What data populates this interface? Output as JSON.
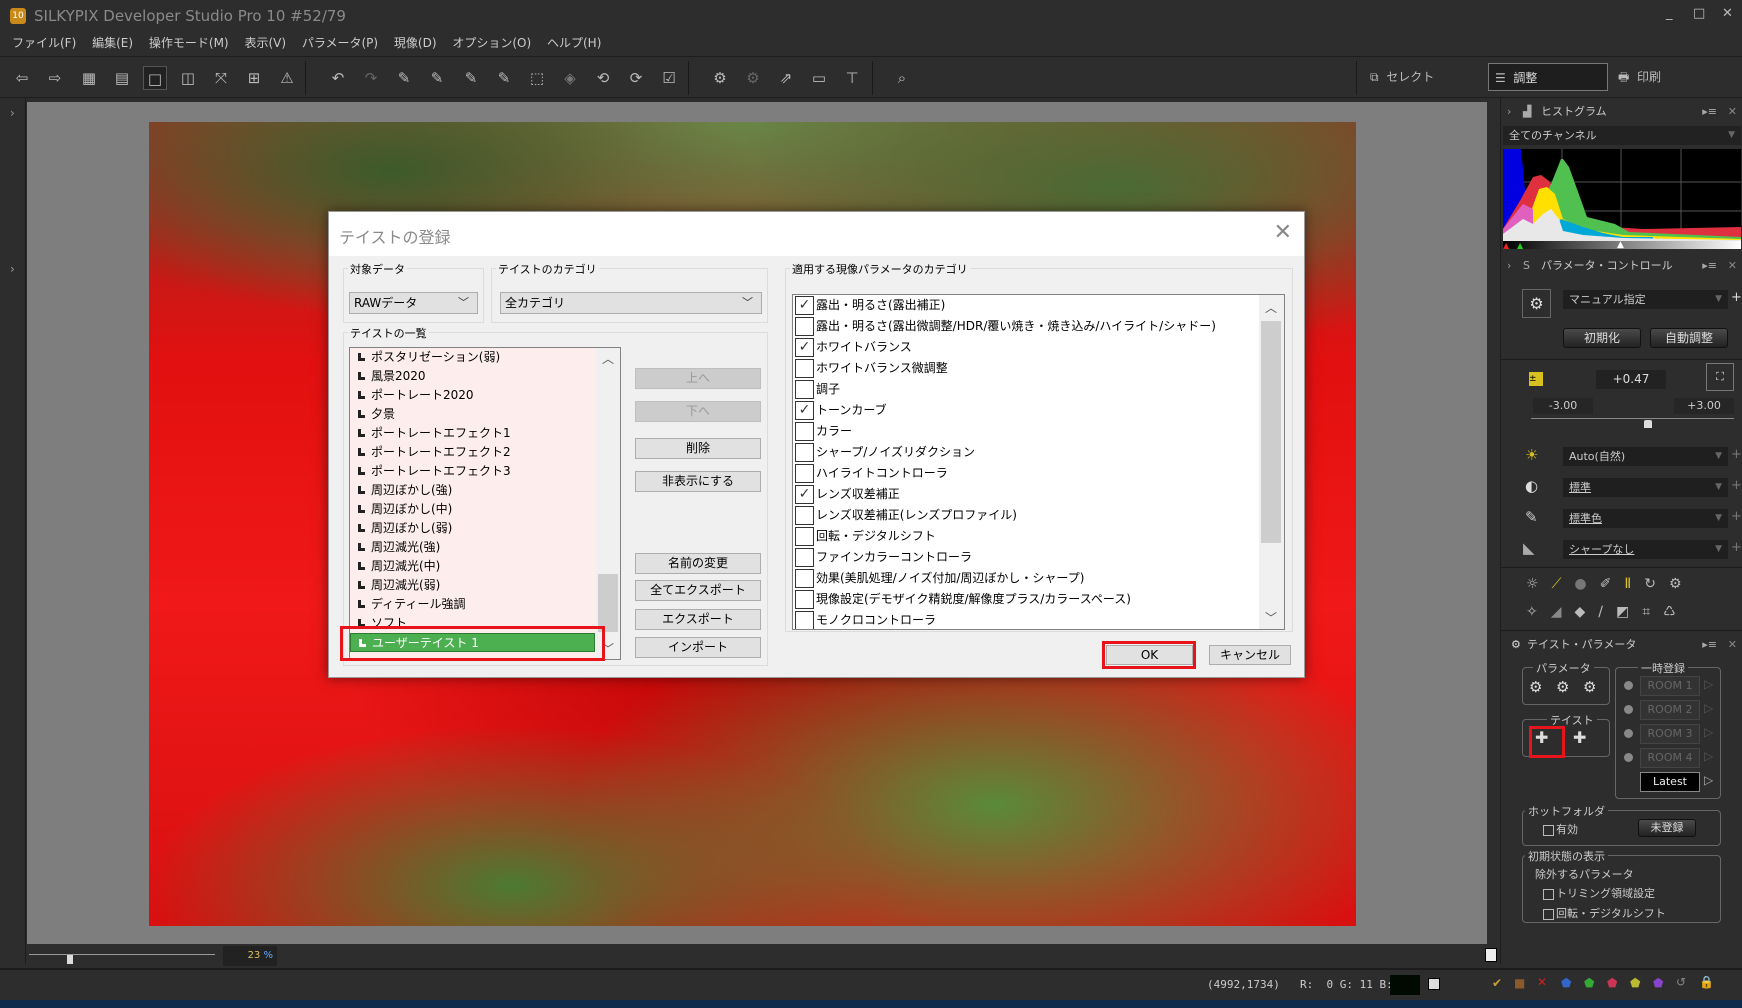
{
  "app": {
    "title": "SILKYPIX Developer Studio Pro 10   #52/79",
    "icon_label": "10"
  },
  "menu": [
    "ファイル(F)",
    "編集(E)",
    "操作モード(M)",
    "表示(V)",
    "パラメータ(P)",
    "現像(D)",
    "オプション(O)",
    "ヘルプ(H)"
  ],
  "modes": {
    "select": "セレクト",
    "adjust": "調整",
    "print": "印刷"
  },
  "zoom": {
    "value": "23",
    "unit": "%"
  },
  "status": {
    "coords": "(4992,1734)",
    "rgb": "R:  0 G: 11 B:  0",
    "swatch_color": "#000a00"
  },
  "dialog": {
    "title": "テイストの登録",
    "target_label": "対象データ",
    "target_value": "RAWデータ",
    "category_label": "テイストのカテゴリ",
    "category_value": "全カテゴリ",
    "list_label": "テイストの一覧",
    "tastes": [
      "ポスタリゼーション(弱)",
      "風景2020",
      "ポートレート2020",
      "夕景",
      "ポートレートエフェクト1",
      "ポートレートエフェクト2",
      "ポートレートエフェクト3",
      "周辺ぼかし(強)",
      "周辺ぼかし(中)",
      "周辺ぼかし(弱)",
      "周辺減光(強)",
      "周辺減光(中)",
      "周辺減光(弱)",
      "ディティール強調",
      "ソフト"
    ],
    "selected_taste": "ユーザーテイスト 1",
    "buttons": {
      "up": "上へ",
      "down": "下へ",
      "delete": "削除",
      "hide": "非表示にする",
      "rename": "名前の変更",
      "export_all": "全てエクスポート",
      "export": "エクスポート",
      "import": "インポート",
      "ok": "OK",
      "cancel": "キャンセル"
    },
    "params_label": "適用する現像パラメータのカテゴリ",
    "params": [
      {
        "label": "露出・明るさ(露出補正)",
        "checked": true
      },
      {
        "label": "露出・明るさ(露出微調整/HDR/覆い焼き・焼き込み/ハイライト/シャドー)",
        "checked": false
      },
      {
        "label": "ホワイトバランス",
        "checked": true
      },
      {
        "label": "ホワイトバランス微調整",
        "checked": false
      },
      {
        "label": "調子",
        "checked": false
      },
      {
        "label": "トーンカーブ",
        "checked": true
      },
      {
        "label": "カラー",
        "checked": false
      },
      {
        "label": "シャープ/ノイズリダクション",
        "checked": false
      },
      {
        "label": "ハイライトコントローラ",
        "checked": false
      },
      {
        "label": "レンズ収差補正",
        "checked": true
      },
      {
        "label": "レンズ収差補正(レンズプロファイル)",
        "checked": false
      },
      {
        "label": "回転・デジタルシフト",
        "checked": false
      },
      {
        "label": "ファインカラーコントローラ",
        "checked": false
      },
      {
        "label": "効果(美肌処理/ノイズ付加/周辺ぼかし・シャープ)",
        "checked": false
      },
      {
        "label": "現像設定(デモザイク精鋭度/解像度プラス/カラースペース)",
        "checked": false
      },
      {
        "label": "モノクロコントローラ",
        "checked": false
      }
    ]
  },
  "histogram": {
    "title": "ヒストグラム",
    "channel": "全てのチャンネル"
  },
  "param_control": {
    "title": "パラメータ・コントロール",
    "preset": "マニュアル指定",
    "reset": "初期化",
    "auto": "自動調整",
    "exposure": "+0.47",
    "min": "-3.00",
    "max": "+3.00",
    "exposure_fraction": 0.578,
    "wb": "Auto(自然)",
    "tone": "標準",
    "color": "標準色",
    "sharp": "シャープなし"
  },
  "taste_param": {
    "title": "テイスト・パラメータ",
    "param_group": "パラメータ",
    "taste_group": "テイスト",
    "temp_group": "一時登録",
    "rooms": [
      "ROOM 1",
      "ROOM 2",
      "ROOM 3",
      "ROOM 4"
    ],
    "latest": "Latest",
    "hot_folder": "ホットフォルダ",
    "enabled": "有効",
    "unregistered": "未登録",
    "initial_display": "初期状態の表示",
    "exclude": "除外するパラメータ",
    "trim": "トリミング領域設定",
    "rotate": "回転・デジタルシフト"
  }
}
